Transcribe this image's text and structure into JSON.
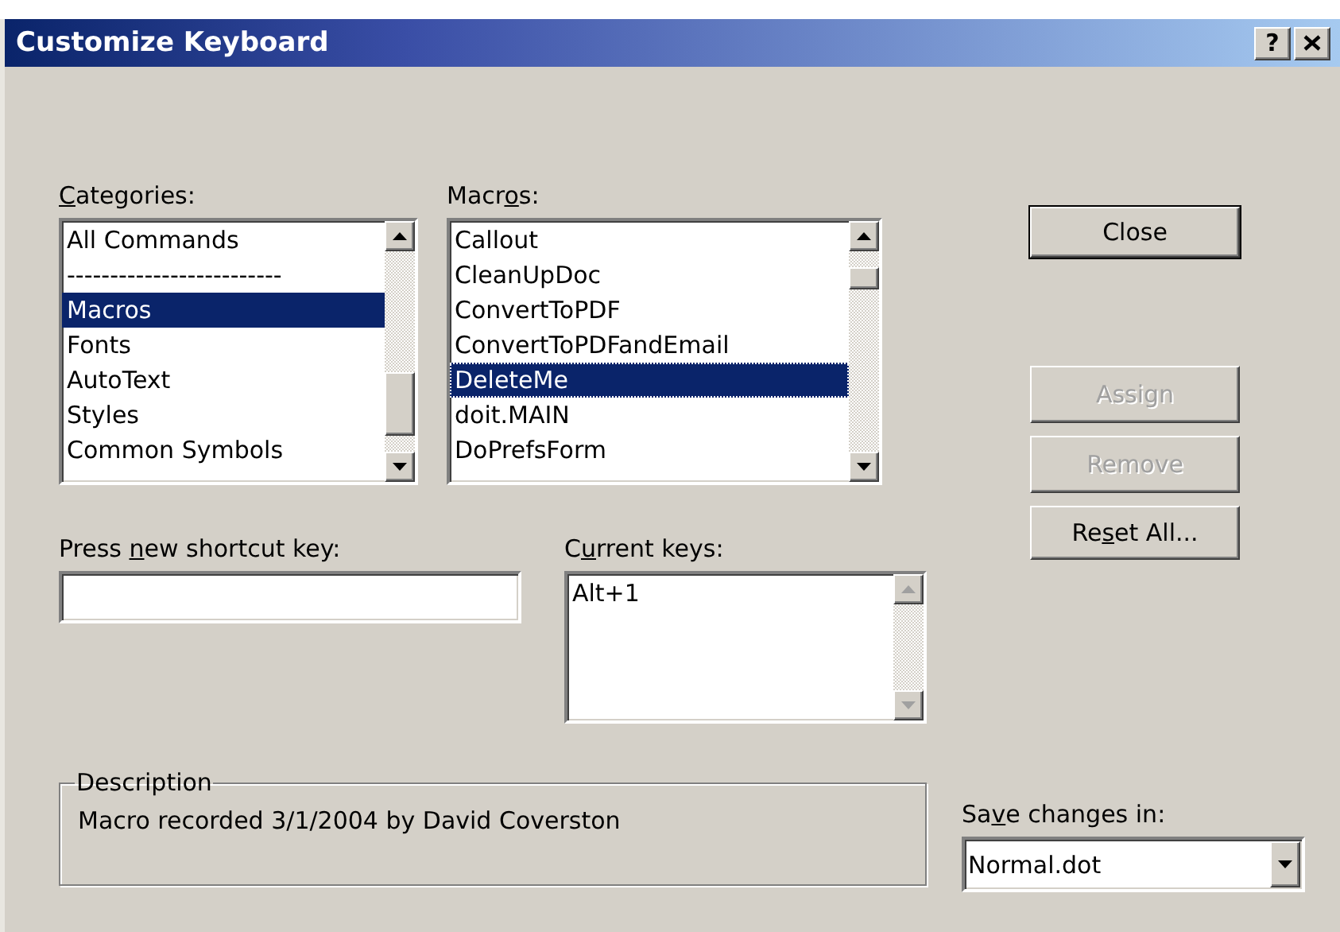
{
  "window": {
    "title": "Customize Keyboard",
    "help_button": "?"
  },
  "categories": {
    "label": {
      "key": "C",
      "after": "ategories:"
    },
    "items": [
      {
        "text": "All Commands",
        "selected": false
      },
      {
        "text": "-------------------------",
        "selected": false
      },
      {
        "text": "Macros",
        "selected": true
      },
      {
        "text": "Fonts",
        "selected": false
      },
      {
        "text": "AutoText",
        "selected": false
      },
      {
        "text": "Styles",
        "selected": false
      },
      {
        "text": "Common Symbols",
        "selected": false
      }
    ]
  },
  "macros": {
    "label": {
      "before": "Macr",
      "key": "o",
      "after": "s:"
    },
    "items": [
      {
        "text": "Callout",
        "selected": false
      },
      {
        "text": "CleanUpDoc",
        "selected": false
      },
      {
        "text": "ConvertToPDF",
        "selected": false
      },
      {
        "text": "ConvertToPDFandEmail",
        "selected": false
      },
      {
        "text": "DeleteMe",
        "selected": true
      },
      {
        "text": "doit.MAIN",
        "selected": false
      },
      {
        "text": "DoPrefsForm",
        "selected": false
      }
    ]
  },
  "shortcut": {
    "label": {
      "before": "Press ",
      "key": "n",
      "after": "ew shortcut key:"
    }
  },
  "current_keys": {
    "label": {
      "before": "C",
      "key": "u",
      "after": "rrent keys:"
    },
    "items": [
      {
        "text": "Alt+1",
        "selected": false
      }
    ]
  },
  "buttons": [
    {
      "label": {
        "before": "Close"
      },
      "disabled": false,
      "default": true
    },
    {
      "label": {
        "before": "Assign"
      },
      "disabled": true,
      "default": false
    },
    {
      "label": {
        "before": "Remove"
      },
      "disabled": true,
      "default": false
    },
    {
      "label": {
        "before": "Re",
        "key": "s",
        "after": "et All..."
      },
      "disabled": false,
      "default": false
    }
  ],
  "description": {
    "legend": "Description",
    "text": "Macro recorded 3/1/2004 by David Coverston"
  },
  "save_in": {
    "label": {
      "before": "Sa",
      "key": "v",
      "after": "e changes in:"
    },
    "value": "Normal.dot"
  }
}
